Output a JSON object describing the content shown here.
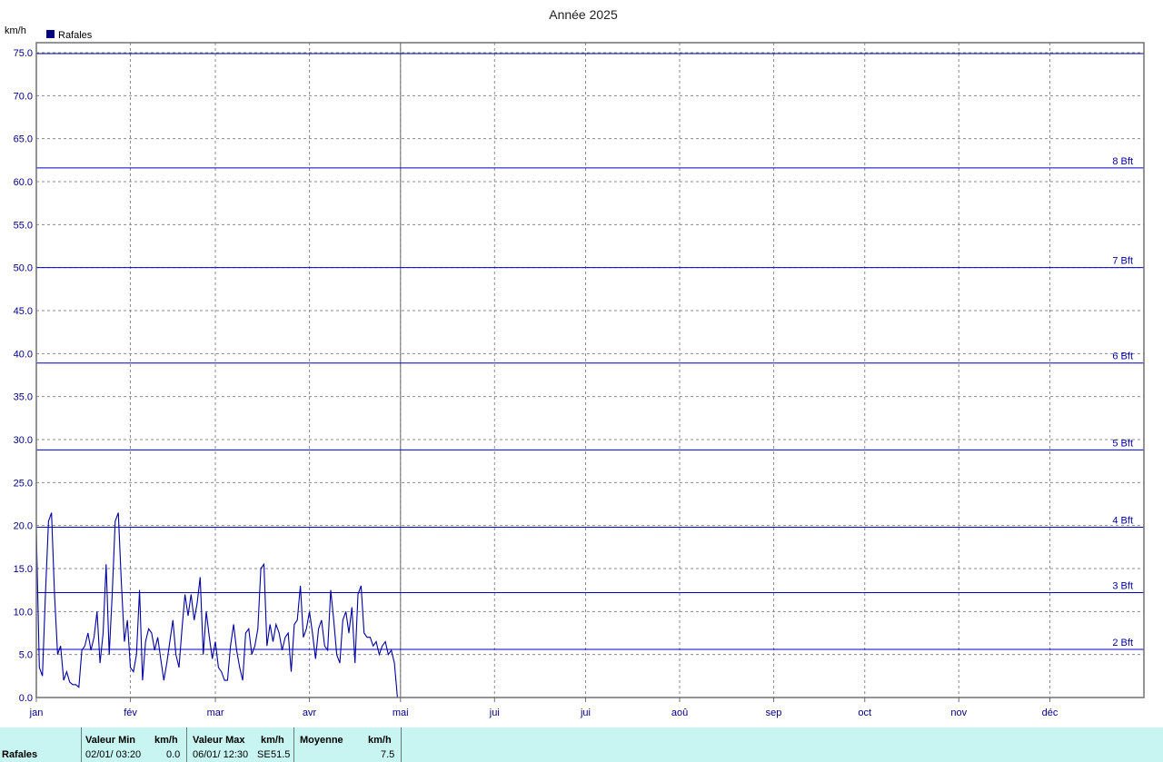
{
  "chart_data": {
    "type": "line",
    "title": "Année 2025",
    "ylabel": "km/h",
    "ylim": [
      0,
      75
    ],
    "yticks": [
      "0.0",
      "5.0",
      "10.0",
      "15.0",
      "20.0",
      "25.0",
      "30.0",
      "35.0",
      "40.0",
      "45.0",
      "50.0",
      "55.0",
      "60.0",
      "65.0",
      "70.0",
      "75.0"
    ],
    "ytick_values": [
      0,
      5,
      10,
      15,
      20,
      25,
      30,
      35,
      40,
      45,
      50,
      55,
      60,
      65,
      70,
      75
    ],
    "xticks": [
      "jan",
      "fév",
      "mar",
      "avr",
      "mai",
      "jui",
      "jui",
      "aoû",
      "sep",
      "oct",
      "nov",
      "déc"
    ],
    "grid": true,
    "legend": {
      "position": "top-left",
      "label": "Rafales",
      "color": "#000080"
    },
    "series_color": "#0000a0",
    "beaufort_lines": [
      {
        "label": "2 Bft",
        "value": 5.6
      },
      {
        "label": "3 Bft",
        "value": 12.2
      },
      {
        "label": "4 Bft",
        "value": 19.8
      },
      {
        "label": "5 Bft",
        "value": 28.8
      },
      {
        "label": "6 Bft",
        "value": 38.9
      },
      {
        "label": "7 Bft",
        "value": 50.0
      },
      {
        "label": "8 Bft",
        "value": 61.6
      }
    ],
    "max_line": 74.9,
    "series": [
      {
        "name": "Rafales",
        "x_days": [
          1,
          2,
          3,
          4,
          5,
          6,
          7,
          8,
          9,
          10,
          11,
          12,
          13,
          14,
          15,
          16,
          17,
          18,
          19,
          20,
          21,
          22,
          23,
          24,
          25,
          26,
          27,
          28,
          29,
          30,
          31,
          32,
          33,
          34,
          35,
          36,
          37,
          38,
          39,
          40,
          41,
          42,
          43,
          44,
          45,
          46,
          47,
          48,
          49,
          50,
          51,
          52,
          53,
          54,
          55,
          56,
          57,
          58,
          59,
          60,
          61,
          62,
          63,
          64,
          65,
          66,
          67,
          68,
          69,
          70,
          71,
          72,
          73,
          74,
          75,
          76,
          77,
          78,
          79,
          80,
          81,
          82,
          83,
          84,
          85,
          86,
          87,
          88,
          89,
          90,
          91,
          92,
          93,
          94,
          95,
          96,
          97,
          98,
          99,
          100,
          101,
          102,
          103,
          104,
          105,
          106,
          107,
          108,
          109,
          110,
          111,
          112,
          113,
          114,
          115,
          116,
          117,
          118,
          119,
          120,
          121
        ],
        "values": [
          19.5,
          3.5,
          2.5,
          12,
          20.5,
          21.5,
          12,
          5,
          6,
          2,
          3,
          1.8,
          1.5,
          1.5,
          1.2,
          5.5,
          6,
          7.5,
          5.5,
          7,
          10,
          4,
          7.5,
          15.5,
          5,
          12,
          20.5,
          21.5,
          13.5,
          6.5,
          9,
          3.5,
          3,
          5,
          12.5,
          2,
          6.5,
          8,
          7.5,
          5.5,
          7,
          4.5,
          2,
          4,
          6.5,
          9,
          5,
          3.5,
          8,
          12,
          9.5,
          12,
          9,
          11,
          14,
          5,
          10,
          7,
          4.5,
          6.5,
          3.5,
          3,
          2,
          2,
          6,
          8.5,
          5.5,
          3.5,
          2,
          7.5,
          8,
          5,
          6,
          8,
          15,
          15.5,
          6,
          8.5,
          6.5,
          8.5,
          7.5,
          5.5,
          7,
          7.5,
          3,
          8.5,
          9,
          13,
          7,
          8,
          10,
          7.5,
          4.5,
          8,
          9,
          6,
          5.5,
          12.5,
          9,
          5,
          4,
          9,
          10,
          7.5,
          10.5,
          4,
          12,
          13,
          7.5,
          7,
          7,
          6,
          6.5,
          5,
          6,
          6.5,
          5,
          5.5,
          4,
          0
        ]
      }
    ]
  },
  "table": {
    "row_label": "Rafales",
    "min_header": "Valeur Min",
    "min_unit": "km/h",
    "min_date": "02/01/  03:20",
    "min_value": "0.0",
    "max_header": "Valeur Max",
    "max_unit": "km/h",
    "max_date": "06/01/  12:30",
    "max_dir": "SE",
    "max_value": "51.5",
    "avg_header": "Moyenne",
    "avg_unit": "km/h",
    "avg_value": "7.5"
  }
}
